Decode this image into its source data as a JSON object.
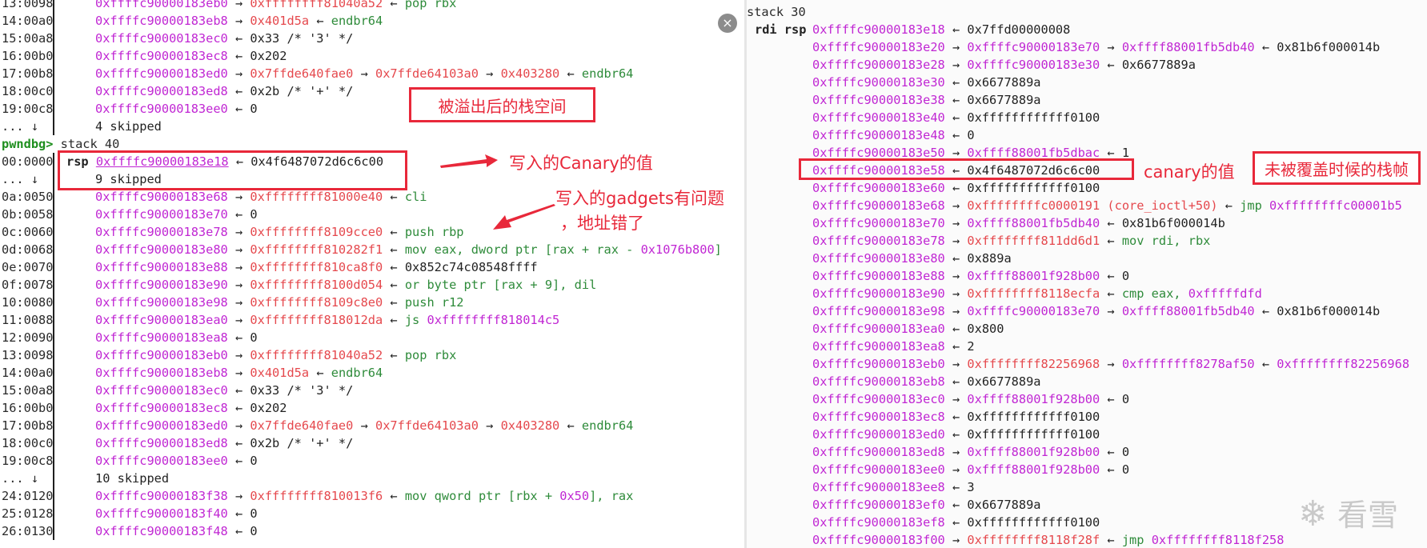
{
  "left_top": [
    {
      "i": "13:0098",
      "a": "0xffffc90000183eb0",
      "p": "→",
      "t": "0xffffffff81040a52",
      "tc": "red",
      "d": "←",
      "c": "pop rbx"
    },
    {
      "i": "14:00a0",
      "a": "0xffffc90000183eb8",
      "p": "→",
      "t": "0x401d5a",
      "tc": "red",
      "d": "←",
      "c": "endbr64"
    },
    {
      "i": "15:00a8",
      "a": "0xffffc90000183ec0",
      "p": "←",
      "t": "0x33 /* '3' */",
      "tc": "grey"
    },
    {
      "i": "16:00b0",
      "a": "0xffffc90000183ec8",
      "p": "←",
      "t": "0x202",
      "tc": "grey"
    },
    {
      "i": "17:00b8",
      "a": "0xffffc90000183ed0",
      "p": "→",
      "t": "0x7ffde640fae0",
      "tc": "red",
      "d": "→",
      "t2": "0x7ffde64103a0",
      "d2": "→",
      "t3": "0x403280",
      "d3": "←",
      "c": "endbr64"
    },
    {
      "i": "18:00c0",
      "a": "0xffffc90000183ed8",
      "p": "←",
      "t": "0x2b /* '+' */",
      "tc": "grey"
    },
    {
      "i": "19:00c8",
      "a": "0xffffc90000183ee0",
      "p": "←",
      "t": "0",
      "tc": "grey"
    }
  ],
  "skip1": {
    "i": "... ↓",
    "text": "4 skipped"
  },
  "prompt": {
    "name": "pwndbg>",
    "cmd": "stack 40"
  },
  "rsp_row": {
    "i": "00:0000",
    "reg": "rsp",
    "a": "0xffffc90000183e18",
    "p": "←",
    "t": "0x4f6487072d6c6c00"
  },
  "skip2": {
    "i": "... ↓",
    "text": "9 skipped"
  },
  "left_main": [
    {
      "i": "0a:0050",
      "a": "0xffffc90000183e68",
      "p": "→",
      "t": "0xffffffff81000e40",
      "tc": "red",
      "d": "←",
      "c": "cli"
    },
    {
      "i": "0b:0058",
      "a": "0xffffc90000183e70",
      "p": "←",
      "t": "0",
      "tc": "grey"
    },
    {
      "i": "0c:0060",
      "a": "0xffffc90000183e78",
      "p": "→",
      "t": "0xffffffff8109cce0",
      "tc": "red",
      "d": "←",
      "c": "push rbp"
    },
    {
      "i": "0d:0068",
      "a": "0xffffc90000183e80",
      "p": "→",
      "t": "0xffffffff810282f1",
      "tc": "red",
      "d": "←",
      "c": "mov eax, dword ptr [rax + rax - 0x1076b800]"
    },
    {
      "i": "0e:0070",
      "a": "0xffffc90000183e88",
      "p": "→",
      "t": "0xffffffff810ca8f0",
      "tc": "red",
      "d": "←",
      "t2": "0x852c74c08548ffff",
      "t2c": "grey"
    },
    {
      "i": "0f:0078",
      "a": "0xffffc90000183e90",
      "p": "→",
      "t": "0xffffffff8100d054",
      "tc": "red",
      "d": "←",
      "c": "or byte ptr [rax + 9], dil"
    },
    {
      "i": "10:0080",
      "a": "0xffffc90000183e98",
      "p": "→",
      "t": "0xffffffff8109c8e0",
      "tc": "red",
      "d": "←",
      "c": "push r12"
    },
    {
      "i": "11:0088",
      "a": "0xffffc90000183ea0",
      "p": "→",
      "t": "0xffffffff818012da",
      "tc": "red",
      "d": "←",
      "c": "js 0xffffffff818014c5"
    },
    {
      "i": "12:0090",
      "a": "0xffffc90000183ea8",
      "p": "←",
      "t": "0",
      "tc": "grey"
    },
    {
      "i": "13:0098",
      "a": "0xffffc90000183eb0",
      "p": "→",
      "t": "0xffffffff81040a52",
      "tc": "red",
      "d": "←",
      "c": "pop rbx"
    },
    {
      "i": "14:00a0",
      "a": "0xffffc90000183eb8",
      "p": "→",
      "t": "0x401d5a",
      "tc": "red",
      "d": "←",
      "c": "endbr64"
    },
    {
      "i": "15:00a8",
      "a": "0xffffc90000183ec0",
      "p": "←",
      "t": "0x33 /* '3' */",
      "tc": "grey"
    },
    {
      "i": "16:00b0",
      "a": "0xffffc90000183ec8",
      "p": "←",
      "t": "0x202",
      "tc": "grey"
    },
    {
      "i": "17:00b8",
      "a": "0xffffc90000183ed0",
      "p": "→",
      "t": "0x7ffde640fae0",
      "tc": "red",
      "d": "→",
      "t2": "0x7ffde64103a0",
      "d2": "→",
      "t3": "0x403280",
      "d3": "←",
      "c": "endbr64"
    },
    {
      "i": "18:00c0",
      "a": "0xffffc90000183ed8",
      "p": "←",
      "t": "0x2b /* '+' */",
      "tc": "grey"
    },
    {
      "i": "19:00c8",
      "a": "0xffffc90000183ee0",
      "p": "←",
      "t": "0",
      "tc": "grey"
    }
  ],
  "skip3": {
    "i": "... ↓",
    "text": "10 skipped"
  },
  "left_bottom": [
    {
      "i": "24:0120",
      "a": "0xffffc90000183f38",
      "p": "→",
      "t": "0xffffffff810013f6",
      "tc": "red",
      "d": "←",
      "c": "mov qword ptr [rbx + 0x50], rax"
    },
    {
      "i": "25:0128",
      "a": "0xffffc90000183f40",
      "p": "←",
      "t": "0",
      "tc": "grey"
    },
    {
      "i": "26:0130",
      "a": "0xffffc90000183f48",
      "p": "←",
      "t": "0",
      "tc": "grey"
    }
  ],
  "right": {
    "cmd": "stack 30",
    "regs": "rdi rsp",
    "rows": [
      {
        "a": "0xffffc90000183e18",
        "p": "←",
        "t": "0x7ffd00000008",
        "tc": "grey"
      },
      {
        "a": "0xffffc90000183e20",
        "p": "→",
        "t": "0xffffc90000183e70",
        "tc": "addr",
        "d": "→",
        "t2": "0xffff88001fb5db40",
        "t2c": "addr",
        "d2": "←",
        "t3": "0x81b6f000014b",
        "t3c": "grey"
      },
      {
        "a": "0xffffc90000183e28",
        "p": "→",
        "t": "0xffffc90000183e30",
        "tc": "addr",
        "d": "←",
        "t2": "0x6677889a",
        "t2c": "grey"
      },
      {
        "a": "0xffffc90000183e30",
        "p": "←",
        "t": "0x6677889a",
        "tc": "grey"
      },
      {
        "a": "0xffffc90000183e38",
        "p": "←",
        "t": "0x6677889a",
        "tc": "grey"
      },
      {
        "a": "0xffffc90000183e40",
        "p": "←",
        "t": "0xffffffffffff0100",
        "tc": "grey"
      },
      {
        "a": "0xffffc90000183e48",
        "p": "←",
        "t": "0",
        "tc": "grey"
      },
      {
        "a": "0xffffc90000183e50",
        "p": "→",
        "t": "0xffff88001fb5dbac",
        "tc": "addr",
        "d": "←",
        "t2": "1",
        "t2c": "grey"
      },
      {
        "a": "0xffffc90000183e58",
        "p": "←",
        "t": "0x4f6487072d6c6c00",
        "tc": "grey"
      },
      {
        "a": "0xffffc90000183e60",
        "p": "←",
        "t": "0xffffffffffff0100",
        "tc": "grey"
      },
      {
        "a": "0xffffc90000183e68",
        "p": "→",
        "t": "0xffffffffc0000191 (core_ioctl+50)",
        "tc": "red",
        "d": "←",
        "c": "jmp",
        "ci": "0xffffffffc00001b5"
      },
      {
        "a": "0xffffc90000183e70",
        "p": "→",
        "t": "0xffff88001fb5db40",
        "tc": "addr",
        "d": "←",
        "t2": "0x81b6f000014b",
        "t2c": "grey"
      },
      {
        "a": "0xffffc90000183e78",
        "p": "→",
        "t": "0xffffffff811dd6d1",
        "tc": "red",
        "d": "←",
        "c": "mov rdi, rbx"
      },
      {
        "a": "0xffffc90000183e80",
        "p": "←",
        "t": "0x889a",
        "tc": "grey"
      },
      {
        "a": "0xffffc90000183e88",
        "p": "→",
        "t": "0xffff88001f928b00",
        "tc": "addr",
        "d": "←",
        "t2": "0",
        "t2c": "grey"
      },
      {
        "a": "0xffffc90000183e90",
        "p": "→",
        "t": "0xffffffff8118ecfa",
        "tc": "red",
        "d": "←",
        "c": "cmp eax,",
        "ci": "0xfffffdfd"
      },
      {
        "a": "0xffffc90000183e98",
        "p": "→",
        "t": "0xffffc90000183e70",
        "tc": "addr",
        "d": "→",
        "t2": "0xffff88001fb5db40",
        "t2c": "addr",
        "d2": "←",
        "t3": "0x81b6f000014b",
        "t3c": "grey"
      },
      {
        "a": "0xffffc90000183ea0",
        "p": "←",
        "t": "0x800",
        "tc": "grey"
      },
      {
        "a": "0xffffc90000183ea8",
        "p": "←",
        "t": "2",
        "tc": "grey"
      },
      {
        "a": "0xffffc90000183eb0",
        "p": "→",
        "t": "0xffffffff82256968",
        "tc": "red",
        "d": "→",
        "t2": "0xffffffff8278af50",
        "t2c": "addr",
        "d2": "←",
        "t3": "0xffffffff82256968",
        "t3c": "addr"
      },
      {
        "a": "0xffffc90000183eb8",
        "p": "←",
        "t": "0x6677889a",
        "tc": "grey"
      },
      {
        "a": "0xffffc90000183ec0",
        "p": "→",
        "t": "0xffff88001f928b00",
        "tc": "addr",
        "d": "←",
        "t2": "0",
        "t2c": "grey"
      },
      {
        "a": "0xffffc90000183ec8",
        "p": "←",
        "t": "0xffffffffffff0100",
        "tc": "grey"
      },
      {
        "a": "0xffffc90000183ed0",
        "p": "←",
        "t": "0xffffffffffff0100",
        "tc": "grey"
      },
      {
        "a": "0xffffc90000183ed8",
        "p": "→",
        "t": "0xffff88001f928b00",
        "tc": "addr",
        "d": "←",
        "t2": "0",
        "t2c": "grey"
      },
      {
        "a": "0xffffc90000183ee0",
        "p": "→",
        "t": "0xffff88001f928b00",
        "tc": "addr",
        "d": "←",
        "t2": "0",
        "t2c": "grey"
      },
      {
        "a": "0xffffc90000183ee8",
        "p": "←",
        "t": "3",
        "tc": "grey"
      },
      {
        "a": "0xffffc90000183ef0",
        "p": "←",
        "t": "0x6677889a",
        "tc": "grey"
      },
      {
        "a": "0xffffc90000183ef8",
        "p": "←",
        "t": "0xffffffffffff0100",
        "tc": "grey"
      },
      {
        "a": "0xffffc90000183f00",
        "p": "→",
        "t": "0xffffffff8118f28f",
        "tc": "red",
        "d": "←",
        "c": "jmp",
        "ci": "0xffffffff8118f258"
      }
    ]
  },
  "annotations": {
    "overflow_stack": "被溢出后的栈空间",
    "canary_written": "写入的Canary的值",
    "gadget_problem_1": "写入的gadgets有问题",
    "gadget_problem_2": "，地址错了",
    "canary_value": "canary的值",
    "uncovered_frame": "未被覆盖时候的栈帧"
  },
  "watermark": "看雪",
  "close_glyph": "×"
}
